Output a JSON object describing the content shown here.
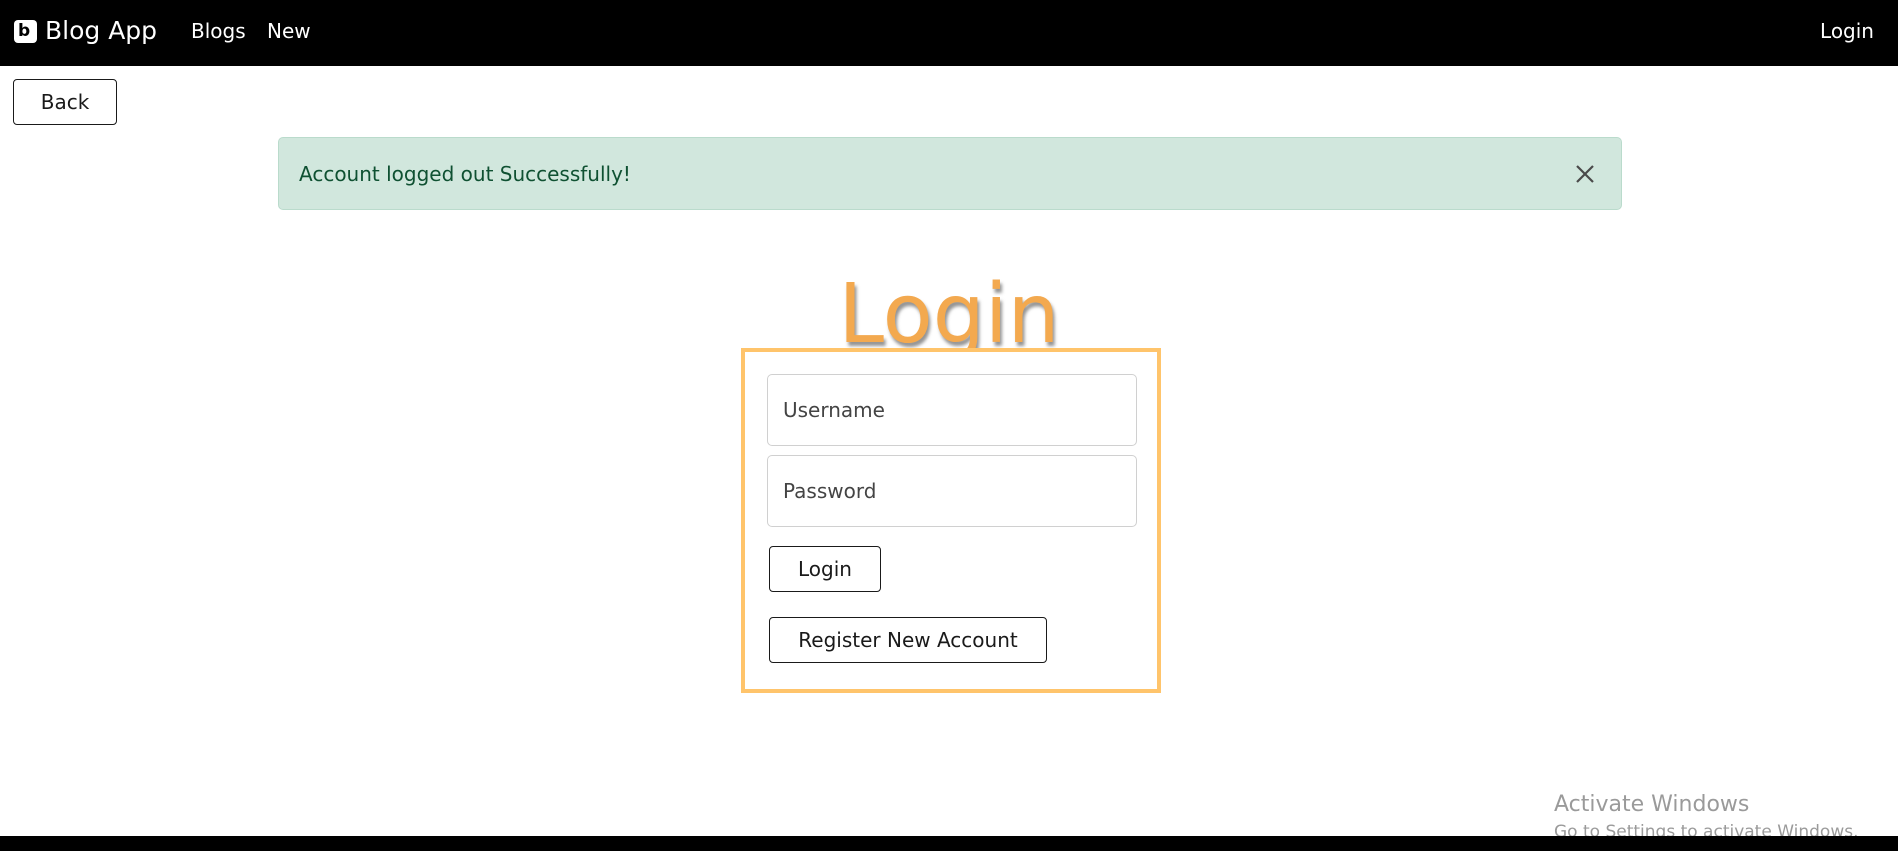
{
  "navbar": {
    "brand_icon": "blogger-icon",
    "brand": "Blog App",
    "links": {
      "blogs": "Blogs",
      "new": "New",
      "login": "Login"
    }
  },
  "back_button": "Back",
  "alert": {
    "message": "Account logged out Successfully!",
    "close_icon": "close-icon"
  },
  "title": "Login",
  "form": {
    "username_placeholder": "Username",
    "password_placeholder": "Password",
    "login_button": "Login",
    "register_button": "Register New Account"
  },
  "watermark": {
    "title": "Activate Windows",
    "subtitle": "Go to Settings to activate Windows."
  },
  "colors": {
    "navbar_bg": "#000000",
    "title": "#f3a94f",
    "form_border": "#ffc46b",
    "alert_bg": "#d1e7dd",
    "alert_text": "#0f5132"
  }
}
